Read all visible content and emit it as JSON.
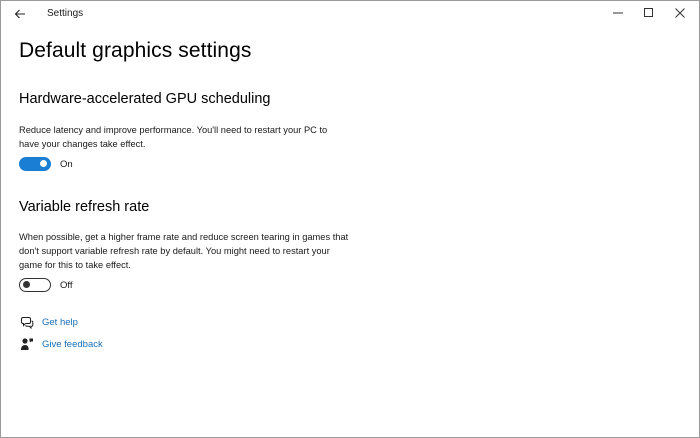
{
  "window": {
    "title": "Settings"
  },
  "page": {
    "title": "Default graphics settings"
  },
  "gpu_scheduling": {
    "title": "Hardware-accelerated GPU scheduling",
    "description": "Reduce latency and improve performance. You'll need to restart your PC to have your changes take effect.",
    "toggle_state": "On",
    "enabled": true
  },
  "variable_refresh": {
    "title": "Variable refresh rate",
    "description": "When possible, get a higher frame rate and reduce screen tearing in games that don't support variable refresh rate by default. You might need to restart your game for this to take effect.",
    "toggle_state": "Off",
    "enabled": false
  },
  "links": {
    "get_help": "Get help",
    "give_feedback": "Give feedback"
  },
  "icons": {
    "back": "back-arrow-icon",
    "minimize": "minimize-icon",
    "maximize": "maximize-icon",
    "close": "close-icon",
    "help": "help-chat-icon",
    "feedback": "feedback-person-icon"
  },
  "colors": {
    "accent": "#1a7fd4",
    "link": "#1a6fb5"
  }
}
